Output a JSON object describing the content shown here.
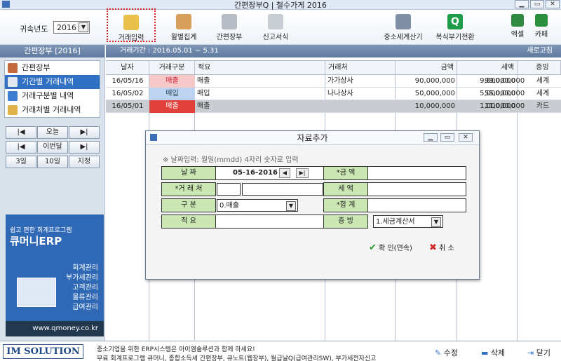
{
  "window": {
    "title": "간편장부Q | 철수가게 2016"
  },
  "fiscal": {
    "label": "귀속년도",
    "year": "2016"
  },
  "toolbar": {
    "items": [
      {
        "label": "거래입력"
      },
      {
        "label": "월별집계"
      },
      {
        "label": "간편장부"
      },
      {
        "label": "신고서식"
      },
      {
        "label": "중소세계산기"
      },
      {
        "label": "복식부기전환"
      },
      {
        "label": "엑셀"
      },
      {
        "label": "카페"
      }
    ]
  },
  "left_panel": {
    "header": "간편장부 [2016]",
    "menu": [
      {
        "label": "간편장부"
      },
      {
        "label": "기간별 거래내역"
      },
      {
        "label": "거래구분별 내역"
      },
      {
        "label": "거래처별 거래내역"
      }
    ],
    "nav": {
      "prev": "|◀",
      "today": "오늘",
      "next": "▶|",
      "prev_month": "|◀",
      "this_month": "이번달",
      "next_month": "▶|",
      "day3": "3일",
      "day10": "10일",
      "specify": "지정"
    },
    "ad": {
      "tagline": "쉽고 편한 회계프로그램",
      "brand": "큐머니ERP",
      "features": [
        "회계관리",
        "부가세관리",
        "고객관리",
        "물류관리",
        "급여관리"
      ],
      "url": "www.qmoney.co.kr"
    }
  },
  "period_bar": {
    "text": "거래기간 : 2016.05.01 ~ 5.31",
    "refresh": "새로고침"
  },
  "table": {
    "headers": [
      "날자",
      "거래구분",
      "적요",
      "거래처",
      "금액",
      "세액",
      "합계",
      "증빙"
    ],
    "rows": [
      {
        "date": "16/05/16",
        "type": "매출",
        "memo": "매출",
        "partner": "가가상사",
        "amount": "90,000,000",
        "tax": "9,000,000",
        "total": "99,000,000",
        "proof": "세계"
      },
      {
        "date": "16/05/02",
        "type": "매입",
        "memo": "매입",
        "partner": "나나상사",
        "amount": "50,000,000",
        "tax": "5,000,000",
        "total": "55,000,000",
        "proof": "세계"
      },
      {
        "date": "16/05/01",
        "type": "매출",
        "memo": "매출",
        "partner": "",
        "amount": "10,000,000",
        "tax": "1,000,000",
        "total": "11,000,000",
        "proof": "카드"
      }
    ]
  },
  "dialog": {
    "title": "자료추가",
    "hint": "※ 날짜입력: 월일(mmdd) 4자리 숫자로 입력",
    "labels": {
      "date": "날 짜",
      "partner": "*거 래 처",
      "kind": "구 분",
      "memo": "적 요",
      "amount": "*금 액",
      "tax": "세 액",
      "total": "*합 계",
      "proof": "증 빙"
    },
    "values": {
      "date": "05-16-2016",
      "kind": "0.매출",
      "proof": "1.세금계산서"
    },
    "confirm": "확 인(연속)",
    "cancel": "취 소"
  },
  "bottom": {
    "logo": "IM SOLUTION",
    "line1": "중소기업을 위한 ERP시스템은 아이엠솔루션과 함께 하세요!",
    "line2": "무료 회계프로그램 큐머니, 종합소득세 간편장부, 큐노트(웹장부), 월급날Q(급여관리SW), 부가세전자신고",
    "edit": "수정",
    "delete": "삭제",
    "close": "닫기"
  },
  "colors": {
    "sale": "#e0413a",
    "sale_light": "#f6c8c8",
    "purchase": "#bcd4f1",
    "selected_row": "#c9ccd1",
    "field_label": "#c9e6b3"
  }
}
